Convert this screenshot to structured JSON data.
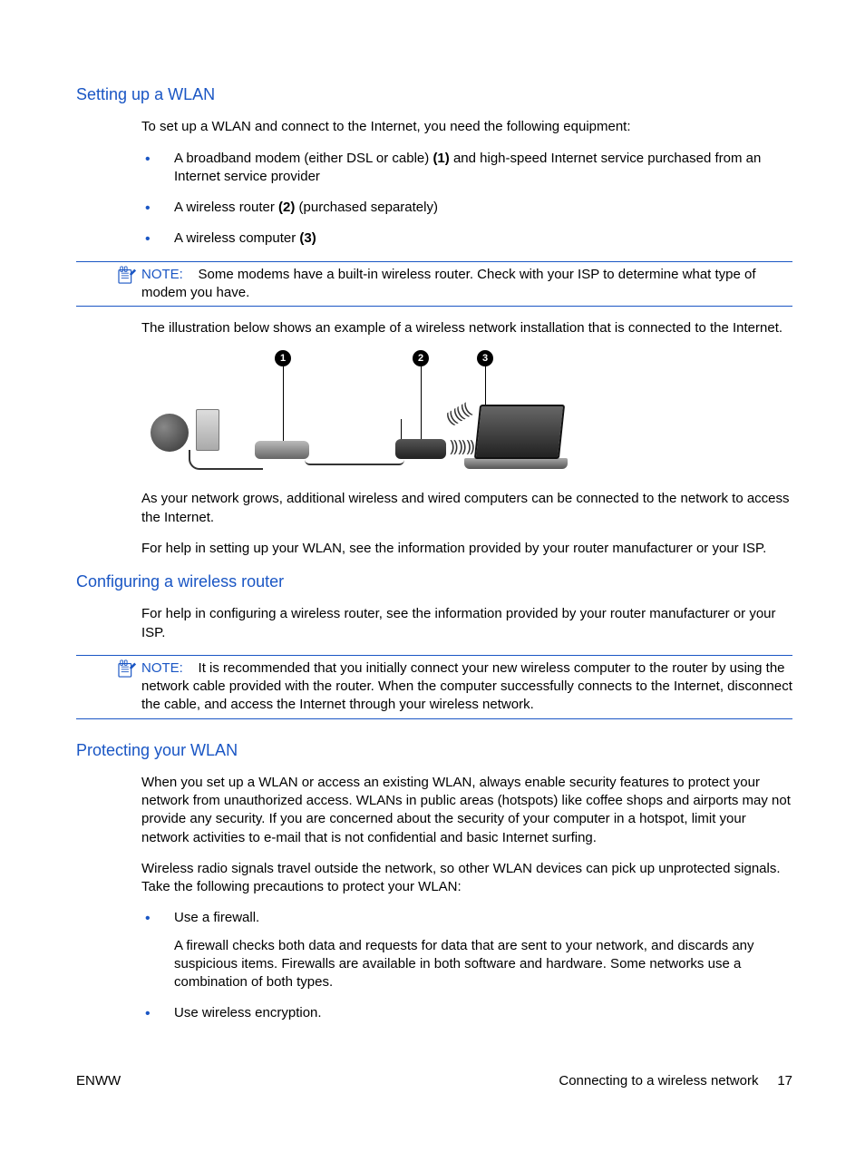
{
  "section1": {
    "heading": "Setting up a WLAN",
    "intro": "To set up a WLAN and connect to the Internet, you need the following equipment:",
    "bullets": [
      {
        "pre": "A broadband modem (either DSL or cable) ",
        "bold": "(1)",
        "post": " and high-speed Internet service purchased from an Internet service provider"
      },
      {
        "pre": "A wireless router ",
        "bold": "(2)",
        "post": " (purchased separately)"
      },
      {
        "pre": "A wireless computer ",
        "bold": "(3)",
        "post": ""
      }
    ],
    "note_label": "NOTE:",
    "note_text": "Some modems have a built-in wireless router. Check with your ISP to determine what type of modem you have.",
    "illus_intro": "The illustration below shows an example of a wireless network installation that is connected to the Internet.",
    "callouts": [
      "1",
      "2",
      "3"
    ],
    "para_after1": "As your network grows, additional wireless and wired computers can be connected to the network to access the Internet.",
    "para_after2": "For help in setting up your WLAN, see the information provided by your router manufacturer or your ISP."
  },
  "section2": {
    "heading": "Configuring a wireless router",
    "para": "For help in configuring a wireless router, see the information provided by your router manufacturer or your ISP.",
    "note_label": "NOTE:",
    "note_text": "It is recommended that you initially connect your new wireless computer to the router by using the network cable provided with the router. When the computer successfully connects to the Internet, disconnect the cable, and access the Internet through your wireless network."
  },
  "section3": {
    "heading": "Protecting your WLAN",
    "para1": "When you set up a WLAN or access an existing WLAN, always enable security features to protect your network from unauthorized access. WLANs in public areas (hotspots) like coffee shops and airports may not provide any security. If you are concerned about the security of your computer in a hotspot, limit your network activities to e-mail that is not confidential and basic Internet surfing.",
    "para2": "Wireless radio signals travel outside the network, so other WLAN devices can pick up unprotected signals. Take the following precautions to protect your WLAN:",
    "bullet1": "Use a firewall.",
    "bullet1_sub": "A firewall checks both data and requests for data that are sent to your network, and discards any suspicious items. Firewalls are available in both software and hardware. Some networks use a combination of both types.",
    "bullet2": "Use wireless encryption."
  },
  "footer": {
    "left": "ENWW",
    "right_text": "Connecting to a wireless network",
    "page": "17"
  }
}
